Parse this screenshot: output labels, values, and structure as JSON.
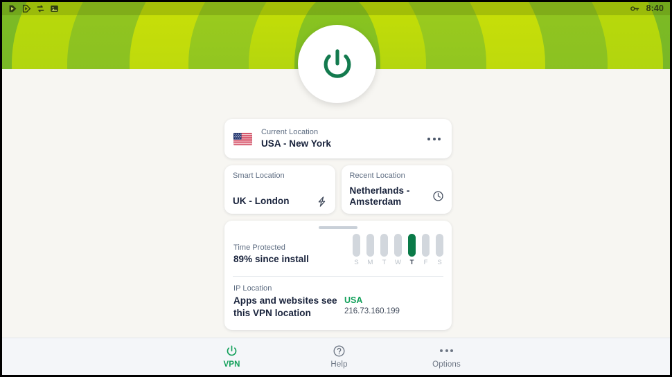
{
  "statusbar": {
    "icons": [
      "media-play-icon",
      "media-play-outline-icon",
      "sync-arrows-icon",
      "image-icon"
    ],
    "vpn_key_icon": "vpn-key-icon",
    "time": "8:40"
  },
  "hero": {
    "power_button_icon": "power-icon",
    "colors": {
      "green_center": "#8cc420",
      "green_bright": "#c5e000",
      "green_deep": "#74b623"
    }
  },
  "current_location": {
    "label": "Current Location",
    "value": "USA - New York",
    "flag_icon": "usa-flag-icon",
    "menu_icon": "overflow-menu-icon"
  },
  "smart_location": {
    "label": "Smart Location",
    "value": "UK - London",
    "icon": "lightning-bolt-icon"
  },
  "recent_location": {
    "label": "Recent Location",
    "value": "Netherlands - Amsterdam",
    "icon": "clock-icon"
  },
  "time_protected": {
    "label": "Time Protected",
    "value": "89% since install"
  },
  "ip_location": {
    "label": "IP Location",
    "description": "Apps and websites see this VPN location",
    "country": "USA",
    "address": "216.73.160.199",
    "country_color": "#12a05a"
  },
  "chart_data": {
    "type": "bar",
    "title": "Time Protected",
    "categories": [
      "S",
      "M",
      "T",
      "W",
      "T",
      "F",
      "S"
    ],
    "values": [
      1,
      1,
      1,
      1,
      1,
      1,
      1
    ],
    "highlight_index": 4,
    "highlight_color": "#0a7a48",
    "bar_color": "#d2d7dd",
    "xlabel": "",
    "ylabel": "",
    "ylim": [
      0,
      1
    ]
  },
  "bottom_nav": [
    {
      "label": "VPN",
      "icon": "power-icon",
      "active": true
    },
    {
      "label": "Help",
      "icon": "question-circle-icon",
      "active": false
    },
    {
      "label": "Options",
      "icon": "overflow-menu-icon",
      "active": false
    }
  ]
}
